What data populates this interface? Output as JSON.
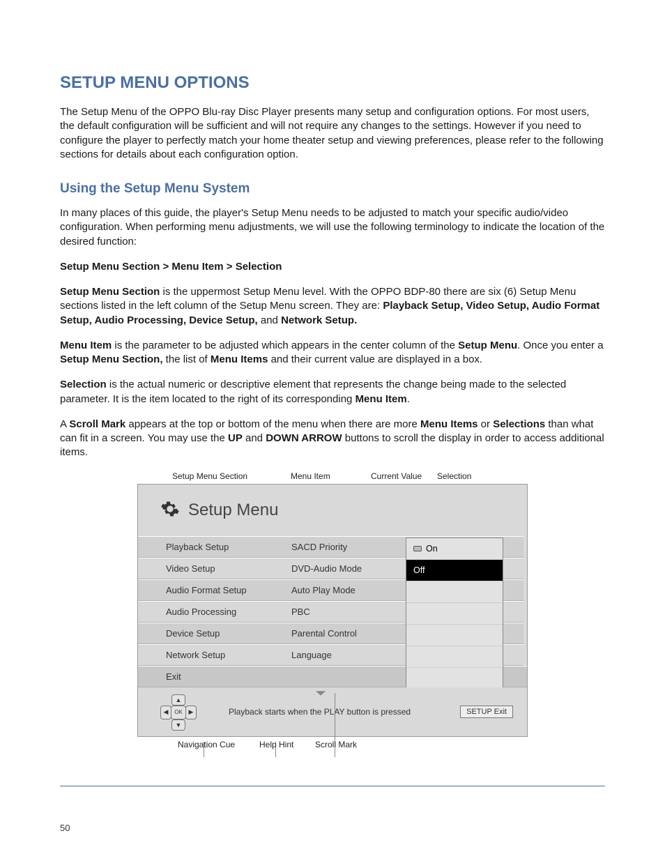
{
  "title": "SETUP MENU OPTIONS",
  "intro": "The Setup Menu of the OPPO Blu-ray Disc Player presents many setup and configuration options.  For most users, the default configuration will be sufficient and will not require any changes to the settings.  However if you need to configure the player to perfectly match your home theater setup and viewing preferences, please refer to the following sections for details about each configuration option.",
  "h2": "Using the Setup Menu System",
  "p2": "In many places of this guide, the player's Setup Menu needs to be adjusted to match your specific audio/video configuration.  When performing menu adjustments, we will use the following terminology to indicate the location of the desired function:",
  "defPath": "Setup Menu Section > Menu Item > Selection",
  "p3a": "Setup Menu Section",
  "p3b": " is the uppermost Setup Menu level. With the OPPO BDP-80 there are six (6) Setup Menu sections listed in the left column of the Setup Menu screen. They are: ",
  "p3c": "Playback Setup, Video Setup, Audio Format Setup, Audio Processing, Device Setup,",
  "p3d": " and ",
  "p3e": "Network Setup.",
  "p4a": "Menu Item",
  "p4b": " is the parameter to be adjusted which appears in the center column of the ",
  "p4c": "Setup Menu",
  "p4d": ". Once you enter a ",
  "p4e": "Setup Menu Section,",
  "p4f": " the list of ",
  "p4g": "Menu Items",
  "p4h": " and their current value are displayed in a box.",
  "p5a": "Selection",
  "p5b": " is the actual numeric or descriptive element that represents the change being made to the selected parameter. It is the item located to the right of its corresponding ",
  "p5c": "Menu Item",
  "p5d": ".",
  "p6a": "A ",
  "p6b": "Scroll Mark",
  "p6c": " appears at the top or bottom of the menu when there are more ",
  "p6d": "Menu Items",
  "p6e": " or ",
  "p6f": "Selections",
  "p6g": " than what can fit in a screen.  You may use the ",
  "p6h": "UP",
  "p6i": " and ",
  "p6j": "DOWN ARROW",
  "p6k": " buttons to scroll the display in order to access additional items.",
  "labels": {
    "top1": "Setup Menu Section",
    "top2": "Menu Item",
    "top3": "Current Value",
    "top4": "Selection",
    "bot1": "Navigation Cue",
    "bot2": "Help Hint",
    "bot3": "Scroll Mark"
  },
  "panel": {
    "title": "Setup Menu",
    "sections": [
      "Playback Setup",
      "Video Setup",
      "Audio Format Setup",
      "Audio Processing",
      "Device Setup",
      "Network Setup"
    ],
    "exit": "Exit",
    "items": [
      "SACD Priority",
      "DVD-Audio Mode",
      "Auto Play Mode",
      "PBC",
      "Parental Control",
      "Language"
    ],
    "selection": {
      "on": "On",
      "off": "Off"
    },
    "hint": "Playback starts when the PLAY button is pressed",
    "setup_btn": "SETUP   Exit",
    "ok": "OK"
  },
  "pagenum": "50"
}
